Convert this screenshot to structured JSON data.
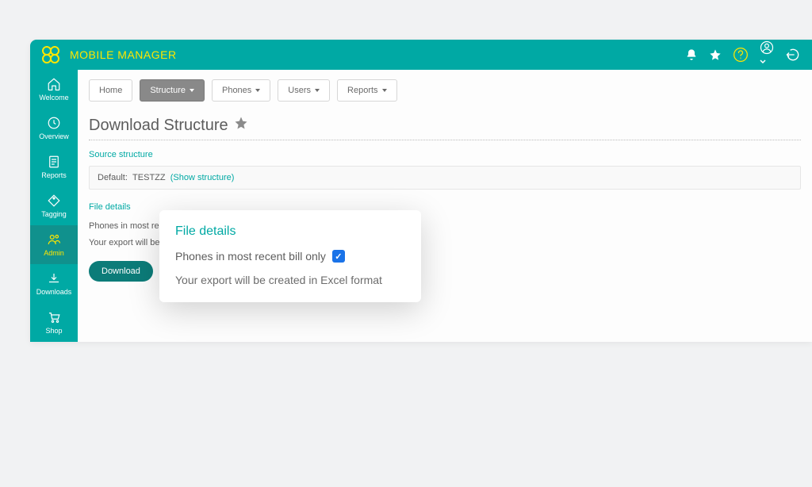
{
  "header": {
    "app_title": "MOBILE MANAGER"
  },
  "sidebar": {
    "items": [
      {
        "label": "Welcome"
      },
      {
        "label": "Overview"
      },
      {
        "label": "Reports"
      },
      {
        "label": "Tagging"
      },
      {
        "label": "Admin"
      },
      {
        "label": "Downloads"
      },
      {
        "label": "Shop"
      }
    ]
  },
  "tabs": {
    "home": "Home",
    "structure": "Structure",
    "phones": "Phones",
    "users": "Users",
    "reports": "Reports"
  },
  "page": {
    "title": "Download Structure",
    "source_label": "Source structure",
    "default_label": "Default:",
    "default_value": "TESTZZ",
    "show_link": "(Show structure)",
    "file_details_label": "File details",
    "bg_line1": "Phones in most rece",
    "bg_line2": "Your export will be c",
    "download_button": "Download"
  },
  "popup": {
    "title": "File details",
    "checkbox_label": "Phones in most recent bill only",
    "checkbox_checked": true,
    "note": "Your export will be created in Excel format"
  }
}
